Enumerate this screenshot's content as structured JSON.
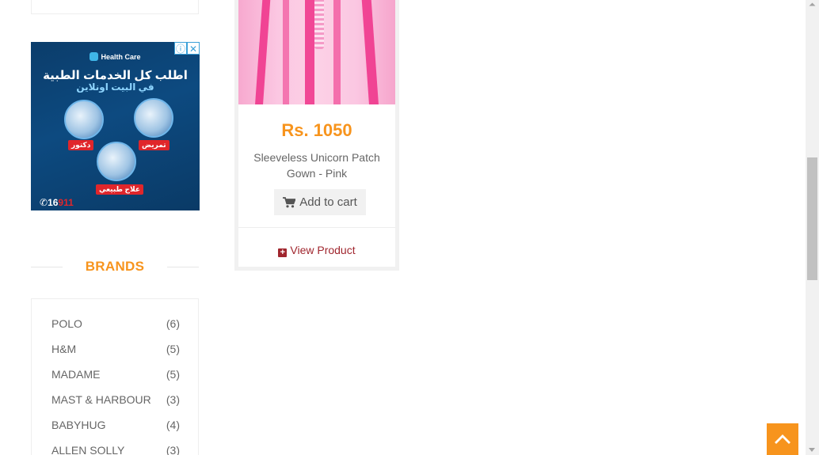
{
  "ad": {
    "brand": "Health Care",
    "headline": "اطلب كل الخدمات الطبية",
    "subheadline": "في البيت اونلاين",
    "tags": [
      "تمريض",
      "دكتور",
      "علاج طبيعي"
    ],
    "phone_prefix": "16",
    "phone_suffix": "911",
    "info_badge": "ⓘ",
    "close_badge": "✕"
  },
  "brands": {
    "title": "BRANDS",
    "items": [
      {
        "name": "POLO",
        "count": "(6)"
      },
      {
        "name": "H&M",
        "count": "(5)"
      },
      {
        "name": "MADAME",
        "count": "(5)"
      },
      {
        "name": "MAST & HARBOUR",
        "count": "(3)"
      },
      {
        "name": "BABYHUG",
        "count": "(4)"
      },
      {
        "name": "ALLEN SOLLY",
        "count": "(3)"
      }
    ]
  },
  "product": {
    "price": "Rs. 1050",
    "name": "Sleeveless Unicorn Patch Gown - Pink",
    "add_to_cart": "Add to cart",
    "view_product": "View Product"
  },
  "colors": {
    "accent": "#f7941d",
    "link": "#a0262e"
  },
  "icons": {
    "cart": "shopping-cart-icon",
    "plus": "plus-square-icon",
    "up": "chevron-up-icon"
  }
}
